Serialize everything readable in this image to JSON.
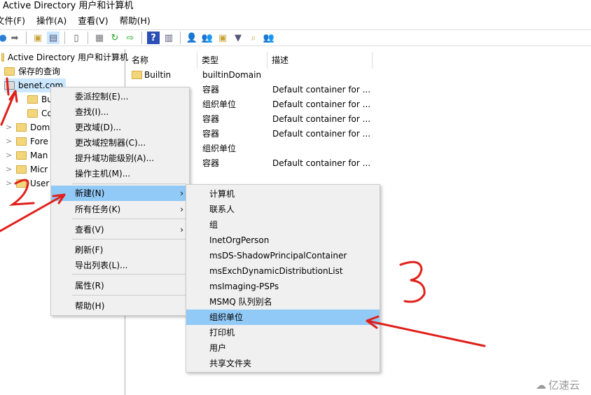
{
  "window": {
    "title": "Active Directory 用户和计算机"
  },
  "menubar": [
    "文件(F)",
    "操作(A)",
    "查看(V)",
    "帮助(H)"
  ],
  "tree": {
    "root": "Active Directory 用户和计算机",
    "saved": "保存的查询",
    "domain": "benet.com",
    "children": [
      "Builtin",
      "Computers",
      "Domain Controllers",
      "ForeignSecurityPrincipals",
      "Managed Service Accounts",
      "Microsoft Exchange Security Groups",
      "Users"
    ],
    "children_visible": [
      "Built",
      "Com",
      "Dom",
      "Fore",
      "Man",
      "Micr",
      "User"
    ]
  },
  "list": {
    "headers": [
      "名称",
      "类型",
      "描述"
    ],
    "rows": [
      {
        "name": "Builtin",
        "type": "builtinDomain",
        "desc": ""
      },
      {
        "name": "",
        "type": "容器",
        "desc": "Default container for ..."
      },
      {
        "name": "",
        "type": "组织单位",
        "desc": "Default container for ..."
      },
      {
        "name": "",
        "type": "容器",
        "desc": "Default container for ..."
      },
      {
        "name": "",
        "type": "容器",
        "desc": "Default container for ..."
      },
      {
        "name": "",
        "type": "组织单位",
        "desc": ""
      },
      {
        "name": "",
        "type": "容器",
        "desc": "Default container for ..."
      }
    ]
  },
  "context_menu": {
    "items": [
      "委派控制(E)...",
      "查找(I)...",
      "更改域(D)...",
      "更改域控制器(C)...",
      "提升域功能级别(A)...",
      "操作主机(M)...",
      "新建(N)",
      "所有任务(K)",
      "查看(V)",
      "刷新(F)",
      "导出列表(L)...",
      "属性(R)",
      "帮助(H)"
    ],
    "highlighted": "新建(N)"
  },
  "submenu": {
    "items": [
      "计算机",
      "联系人",
      "组",
      "InetOrgPerson",
      "msDS-ShadowPrincipalContainer",
      "msExchDynamicDistributionList",
      "msImaging-PSPs",
      "MSMQ 队列别名",
      "组织单位",
      "打印机",
      "用户",
      "共享文件夹"
    ],
    "highlighted": "组织单位"
  },
  "annotations": {
    "labels": [
      "1",
      "2",
      "3"
    ],
    "color": "#e0201a"
  },
  "watermark": "亿速云",
  "colors": {
    "highlight": "#91c9f7",
    "menu_bg": "#f0f0f0",
    "selection": "#cce8ff"
  }
}
